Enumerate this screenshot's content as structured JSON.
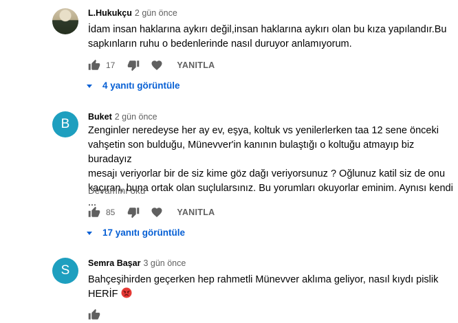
{
  "comments": [
    {
      "author": "L.Hukukçu",
      "time": "2 gün önce",
      "text": "İdam insan haklarına aykırı değil,insan haklarına aykırı olan bu kıza yapılandır.Bu\nsapkınların ruhu o bedenlerinde nasıl duruyor anlamıyorum.",
      "likes": "17",
      "reply_label": "YANITLA",
      "replies_label": "4 yanıtı görüntüle"
    },
    {
      "author": "Buket",
      "time": "2 gün önce",
      "avatar_letter": "B",
      "avatar_color": "#1e9fbf",
      "text": "Zenginler neredeyse her ay ev, eşya, koltuk vs yenilerlerken taa 12 sene önceki\nvahşetin son bulduğu, Münevver'in kanının bulaştığı o koltuğu atmayıp biz buradayız\nmesajı veriyorlar bir de siz kime göz dağı veriyorsunuz ? Oğlunuz katil siz de onu\nkaçıran, buna ortak olan suçlularsınız. Bu yorumları okuyorlar eminim. Aynısı kendi ...",
      "read_more": "Devamını oku",
      "likes": "85",
      "reply_label": "YANITLA",
      "replies_label": "17 yanıtı görüntüle"
    },
    {
      "author": "Semra Başar",
      "time": "3 gün önce",
      "avatar_letter": "S",
      "avatar_color": "#1e9fbf",
      "text": "Bahçeşihirden geçerken hep rahmetli Münevver aklıma geliyor, nasıl kıydı pislik\nHERİF"
    }
  ],
  "icons": {
    "like": "thumb-up-icon",
    "dislike": "thumb-down-icon",
    "heart": "heart-icon",
    "caret": "caret-down-icon",
    "emoji": "angry-face-emoji"
  }
}
